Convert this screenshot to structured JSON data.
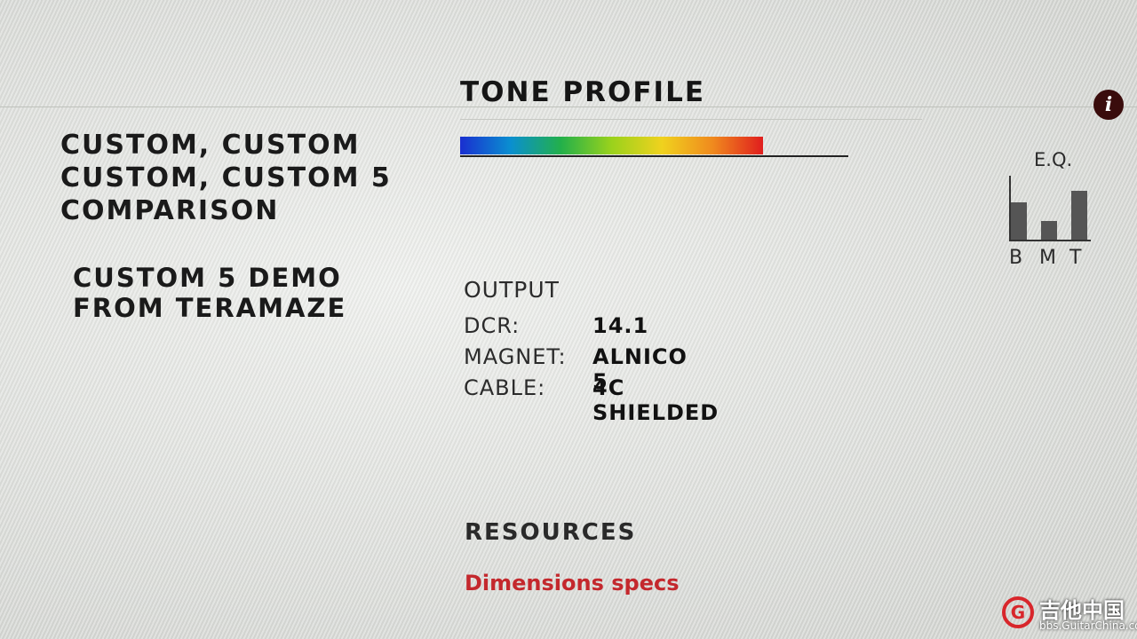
{
  "sidebar": {
    "comparison_link": "CUSTOM, CUSTOM CUSTOM, CUSTOM 5 COMPARISON",
    "demo_link": "CUSTOM 5 DEMO FROM TERAMAZE"
  },
  "tone_profile": {
    "title": "TONE PROFILE",
    "level": 0.78,
    "gradient_colors": [
      "#1a2fd0",
      "#0a8fd0",
      "#23b04a",
      "#9ad21c",
      "#f0d21e",
      "#f08a1e",
      "#e01e1e"
    ]
  },
  "info_icon": {
    "glyph": "i",
    "icon": "info-icon",
    "color": "#3a0c0c"
  },
  "eq": {
    "title": "E.Q.",
    "bands": [
      {
        "label": "B",
        "level": 0.6
      },
      {
        "label": "M",
        "level": 0.3
      },
      {
        "label": "T",
        "level": 0.78
      }
    ]
  },
  "output": {
    "heading": "OUTPUT",
    "specs": [
      {
        "label": "DCR:",
        "value": "14.1"
      },
      {
        "label": "MAGNET:",
        "value": "ALNICO 5"
      },
      {
        "label": "CABLE:",
        "value": "4C SHIELDED"
      }
    ]
  },
  "resources": {
    "title": "RESOURCES",
    "link": "Dimensions specs",
    "link_color": "#c4282d"
  },
  "watermark": {
    "logo": "G",
    "site_name": "吉他中国",
    "url": "bbs.GuitarChina.com"
  }
}
